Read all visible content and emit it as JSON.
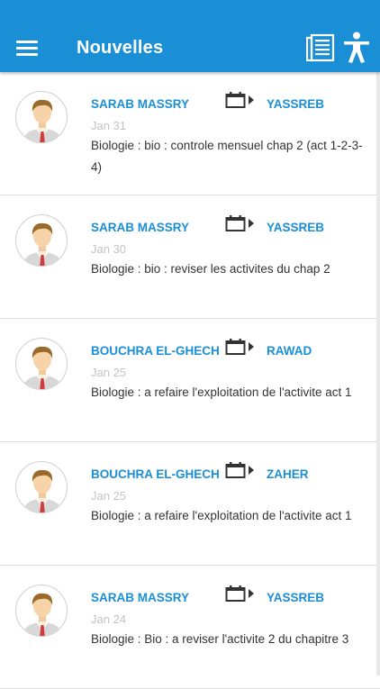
{
  "header": {
    "title": "Nouvelles",
    "menu_icon": "hamburger-menu-icon",
    "actions": [
      "newspaper-icon",
      "accessibility-icon"
    ],
    "accent_color": "#1b8fd6"
  },
  "news": [
    {
      "sender": "SARAB MASSRY",
      "class_name": "YASSREB",
      "date": "Jan 31",
      "message": "Biologie : bio : controle mensuel chap 2 (act 1-2-3-4)"
    },
    {
      "sender": "SARAB MASSRY",
      "class_name": "YASSREB",
      "date": "Jan 30",
      "message": "Biologie : bio : reviser les activites du chap 2"
    },
    {
      "sender": "BOUCHRA EL-GHECH",
      "class_name": "RAWAD",
      "date": "Jan 25",
      "message": "Biologie : a refaire l'exploitation de l'activite act 1"
    },
    {
      "sender": "BOUCHRA EL-GHECH",
      "class_name": "ZAHER",
      "date": "Jan 25",
      "message": "Biologie : a refaire l'exploitation de l'activite act 1"
    },
    {
      "sender": "SARAB MASSRY",
      "class_name": "YASSREB",
      "date": "Jan 24",
      "message": "Biologie : Bio : a reviser l'activite 2 du chapitre 3"
    }
  ]
}
